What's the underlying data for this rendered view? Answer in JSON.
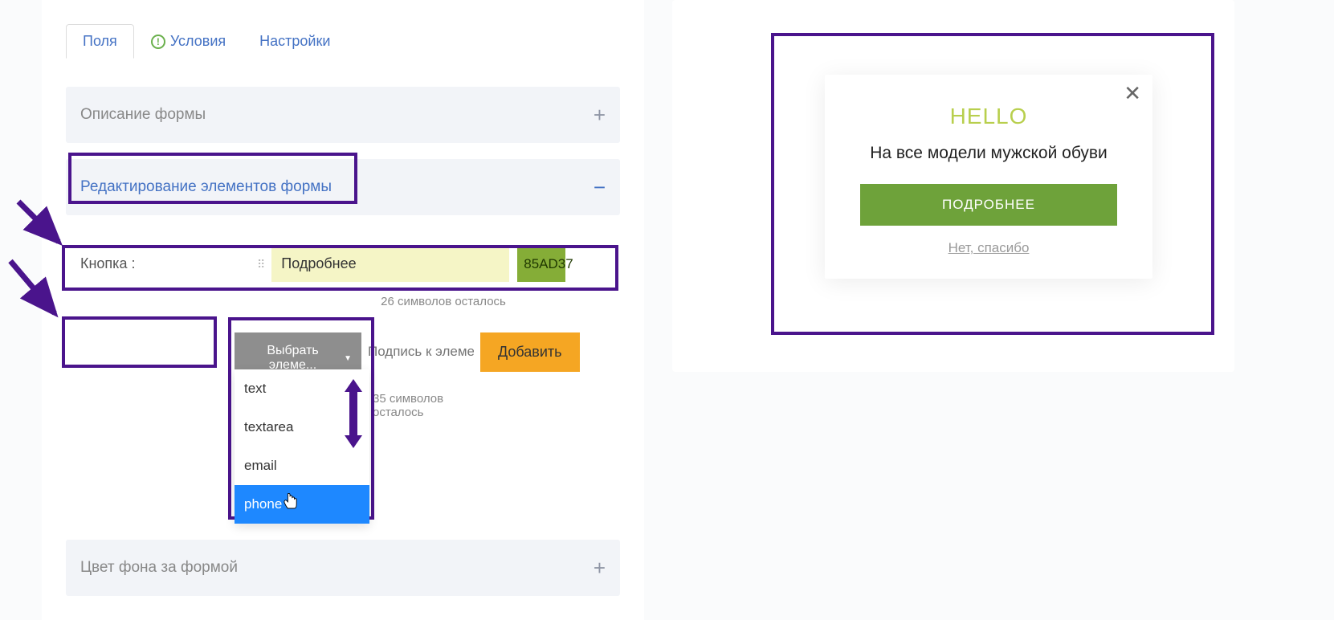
{
  "tabs": {
    "fields": "Поля",
    "conditions": "Условия",
    "settings": "Настройки"
  },
  "sections": {
    "description": "Описание формы",
    "editing": "Редактирование элементов формы",
    "bgcolor": "Цвет фона за формой"
  },
  "buttonRow": {
    "label": "Кнопка :",
    "value": "Подробнее",
    "colorHex": "85AD37",
    "charsLeft": "26 символов осталось"
  },
  "addRow": {
    "selectLabel": "Выбрать элеме...",
    "placeholder": "Подпись к элеме",
    "addLabel": "Добавить",
    "charsLeft": "35 символов осталось"
  },
  "dropdown": {
    "opt0": "text",
    "opt1": "textarea",
    "opt2": "email",
    "opt3": "phone"
  },
  "preview": {
    "title": "HELLO",
    "subtitle": "На все модели мужской обуви",
    "button": "ПОДРОБНЕЕ",
    "decline": "Нет, спасибо"
  }
}
